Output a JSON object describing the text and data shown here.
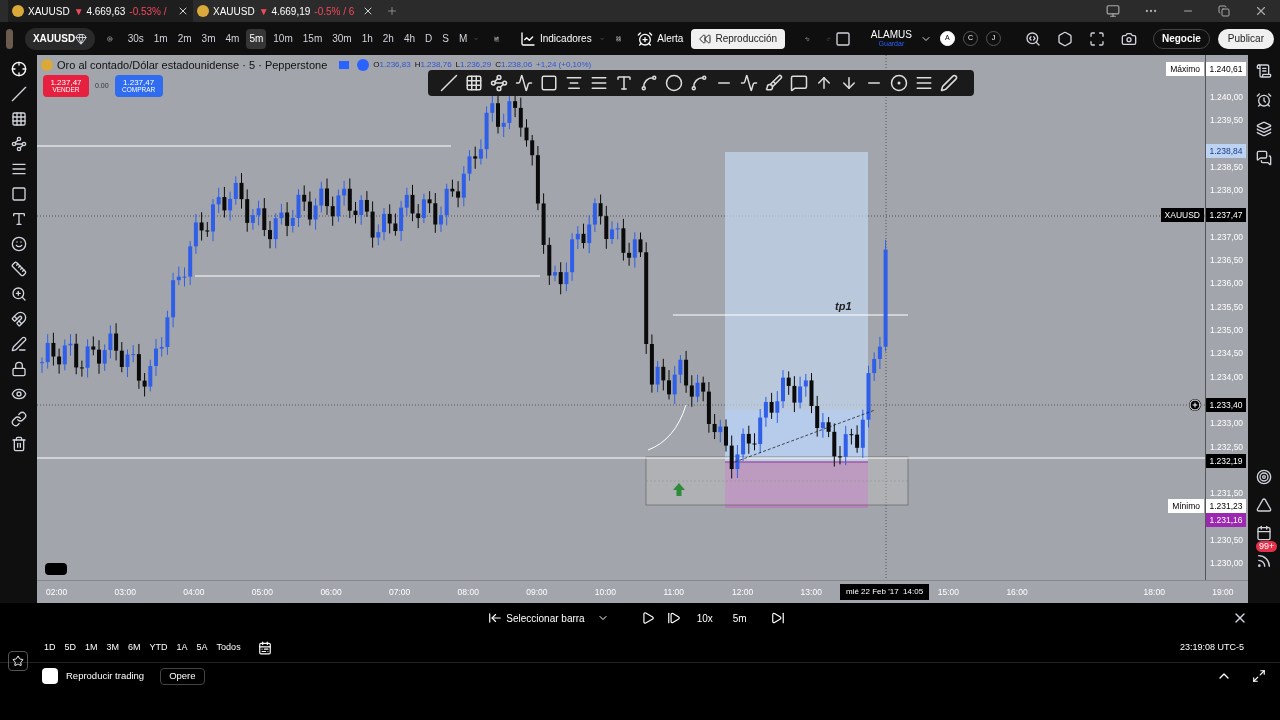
{
  "tabs": [
    {
      "symbol": "XAUUSD",
      "arrow": "▼",
      "price": "4.669,63",
      "change": "-0.53% /",
      "selected": true
    },
    {
      "symbol": "XAUUSD",
      "arrow": "▼",
      "price": "4.669,19",
      "change": "-0.5% / 6",
      "selected": false
    }
  ],
  "toolbar": {
    "symbol": "XAUUSD",
    "intervals": [
      {
        "label": "30s",
        "selected": false
      },
      {
        "label": "1m",
        "selected": false
      },
      {
        "label": "2m",
        "selected": false
      },
      {
        "label": "3m",
        "selected": false
      },
      {
        "label": "4m",
        "selected": false
      },
      {
        "label": "5m",
        "selected": true
      },
      {
        "label": "10m",
        "selected": false
      },
      {
        "label": "15m",
        "selected": false
      },
      {
        "label": "30m",
        "selected": false
      },
      {
        "label": "1h",
        "selected": false
      },
      {
        "label": "2h",
        "selected": false
      },
      {
        "label": "4h",
        "selected": false
      },
      {
        "label": "D",
        "selected": false
      },
      {
        "label": "S",
        "selected": false
      },
      {
        "label": "M",
        "selected": false
      }
    ],
    "indicators": "Indicadores",
    "alert": "Alerta",
    "replay": {
      "label": "Reproducción",
      "selected": true
    },
    "layout": {
      "name": "ALAMUS",
      "status": "Guardar"
    },
    "avatars": [
      {
        "letter": "A",
        "selected": true
      },
      {
        "letter": "C",
        "selected": false
      },
      {
        "letter": "J",
        "selected": false
      }
    ],
    "trade": "Negocie",
    "publish": "Publicar"
  },
  "chart": {
    "title": "Oro al contado/Dólar estadounidense · 5 · Pepperstone",
    "ohlc": [
      {
        "key": "O",
        "value": "1.236,83"
      },
      {
        "key": "H",
        "value": "1.238,76"
      },
      {
        "key": "L",
        "value": "1.236,29"
      },
      {
        "key": "C",
        "value": "1.238,06"
      }
    ],
    "change": "+1,24 (+0,10%)",
    "sell": {
      "price": "1.237,47",
      "label": "VENDER"
    },
    "spread": "0.00",
    "buy": {
      "price": "1.237,47",
      "label": "COMPRAR"
    },
    "annotation": "tp1",
    "price_ticks": [
      "1.240,00",
      "1.239,50",
      "1.238,50",
      "1.238,00",
      "1.237,00",
      "1.236,50",
      "1.236,00",
      "1.235,50",
      "1.235,00",
      "1.234,50",
      "1.234,00",
      "1.233,00",
      "1.232,50",
      "1.231,50",
      "1.230,50",
      "1.230,00"
    ],
    "price_labels": [
      {
        "kind": "max",
        "caption": "Máximo",
        "value": "1.240,61"
      },
      {
        "kind": "highlight",
        "value": "1.238,84"
      },
      {
        "kind": "symbol",
        "caption": "XAUUSD",
        "value": "1.237,47"
      },
      {
        "kind": "crosshair",
        "value": "1.233,40"
      },
      {
        "kind": "dark",
        "value": "1.232,19"
      },
      {
        "kind": "min",
        "caption": "Mínimo",
        "value": "1.231,23"
      },
      {
        "kind": "purple",
        "value": "1.231,16"
      }
    ],
    "time_ticks": [
      "02:00",
      "03:00",
      "04:00",
      "05:00",
      "06:00",
      "07:00",
      "08:00",
      "09:00",
      "10:00",
      "11:00",
      "12:00",
      "13:00",
      "15:00",
      "16:00",
      "18:00",
      "19:00"
    ],
    "crosshair_time": "mié 22 Feb '17  14:05"
  },
  "replay_bar": {
    "select": "Seleccionar barra",
    "speed": "10x",
    "interval": "5m"
  },
  "ranges": [
    "1D",
    "5D",
    "1M",
    "3M",
    "6M",
    "YTD",
    "1A",
    "5A",
    "Todos"
  ],
  "clock": "23:19:08 UTC-5",
  "bottom": {
    "replay_trading": "Reproducir trading",
    "trade": "Opere"
  },
  "notifications_badge": "99+"
}
